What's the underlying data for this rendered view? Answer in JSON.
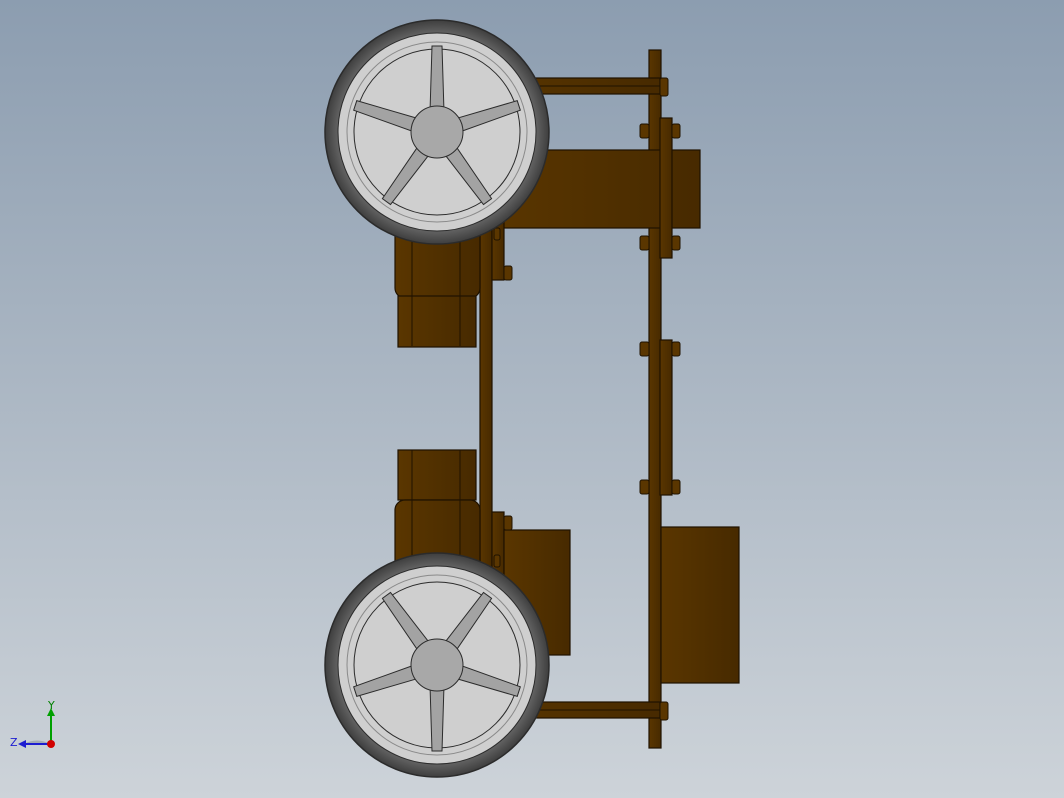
{
  "viewport": {
    "background_top": "#8c9db0",
    "background_bottom": "#cdd3d9"
  },
  "model": {
    "part_color": "#4e2f00",
    "edge_color": "#1f1200",
    "tire_color": "#4d4d4d",
    "rim_color": "#bdbdbd",
    "hub_color": "#a8a8a8",
    "wheels": [
      "top-wheel",
      "bottom-wheel"
    ]
  },
  "triad": {
    "x_label": "",
    "y_label": "Y",
    "z_label": "Z",
    "x_color": "#d10000",
    "y_color": "#00a000",
    "z_color": "#1d1dd1"
  }
}
